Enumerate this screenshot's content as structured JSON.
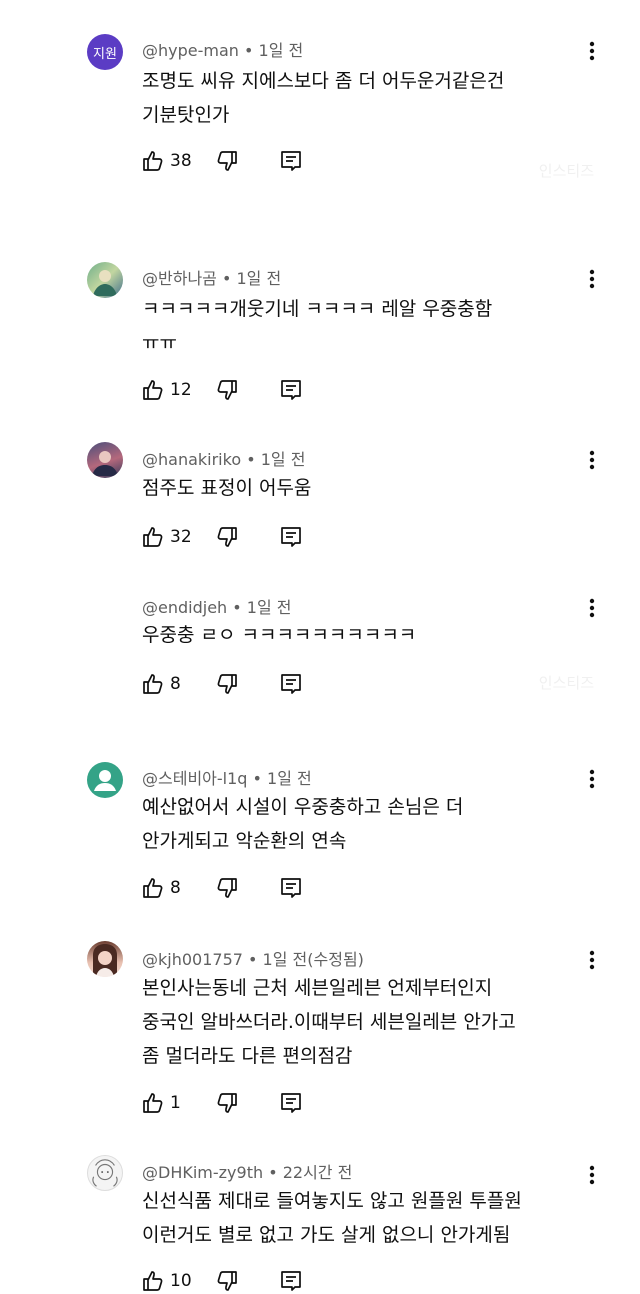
{
  "comments": [
    {
      "handle": "@hype-man",
      "time": "1일 전",
      "edited": "",
      "text": "조명도 씨유 지에스보다 좀 더 어두운거같은건\n기분탓인가",
      "likes": "38",
      "avatar_text": "지원"
    },
    {
      "handle": "@반하나곰",
      "time": "1일 전",
      "edited": "",
      "text": "ㅋㅋㅋㅋㅋ개웃기네 ㅋㅋㅋㅋ 레알 우중충함\nㅠㅠ",
      "likes": "12",
      "avatar_text": ""
    },
    {
      "handle": "@hanakiriko",
      "time": "1일 전",
      "edited": "",
      "text": "점주도 표정이 어두움",
      "likes": "32",
      "avatar_text": ""
    },
    {
      "handle": "@endidjeh",
      "time": "1일 전",
      "edited": "",
      "text": "우중충 ㄹㅇ ㅋㅋㅋㅋㅋㅋㅋㅋㅋㅋ",
      "likes": "8",
      "avatar_text": ""
    },
    {
      "handle": "@스테비아-l1q",
      "time": "1일 전",
      "edited": "",
      "text": "예산없어서 시설이 우중충하고 손님은 더\n안가게되고 악순환의 연속",
      "likes": "8",
      "avatar_text": ""
    },
    {
      "handle": "@kjh001757",
      "time": "1일 전",
      "edited": "(수정됨)",
      "text": "본인사는동네 근처 세븐일레븐 언제부터인지\n중국인 알바쓰더라.이때부터 세븐일레븐 안가고\n좀 멀더라도 다른 편의점감",
      "likes": "1",
      "avatar_text": ""
    },
    {
      "handle": "@DHKim-zy9th",
      "time": "22시간 전",
      "edited": "",
      "text": "신선식품 제대로 들여놓지도 않고 원플원 투플원\n이런거도 별로 없고 가도 살게 없으니 안가게됨",
      "likes": "10",
      "avatar_text": ""
    }
  ],
  "separator": " • ",
  "watermark": "인스티즈",
  "icons": {
    "like": "thumb-up-icon",
    "dislike": "thumb-down-icon",
    "reply": "reply-icon",
    "more": "more-vert-icon"
  }
}
